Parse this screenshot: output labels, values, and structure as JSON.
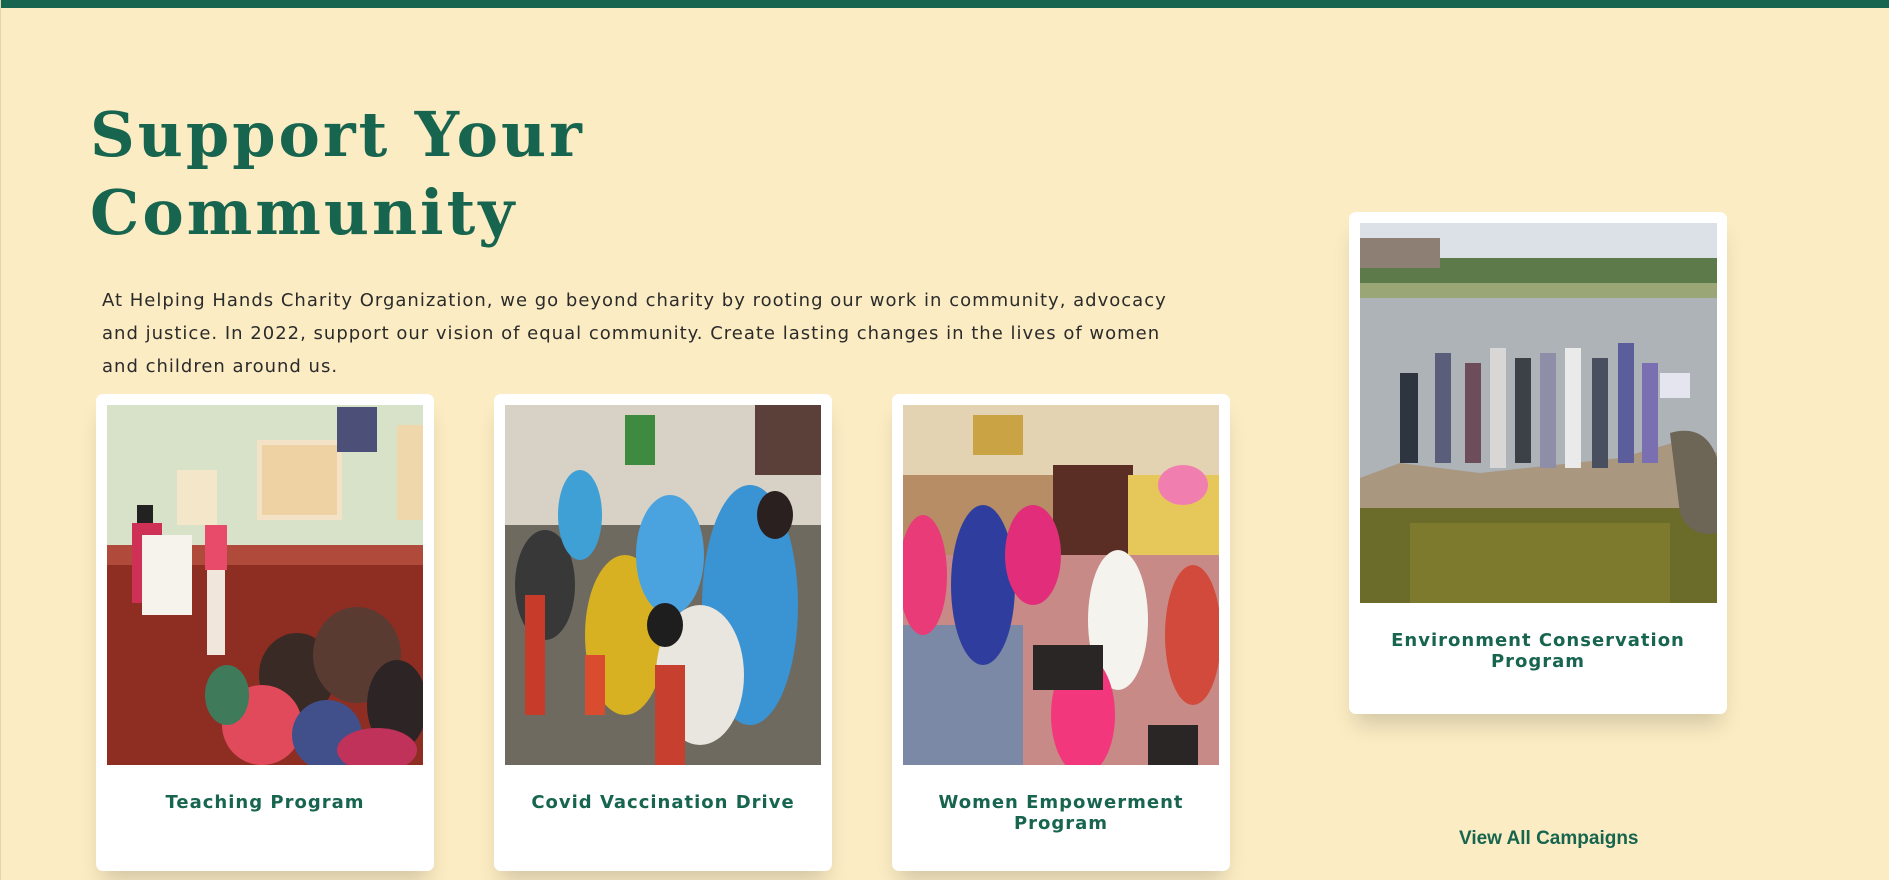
{
  "section": {
    "heading_line1": "Support Your",
    "heading_line2": "Community",
    "intro_text": "At Helping Hands Charity Organization, we go beyond charity by rooting our work in community, advocacy and justice. In 2022, support our vision of equal community. Create lasting changes in the lives of women and children around us."
  },
  "campaigns": [
    {
      "title": "Teaching Program"
    },
    {
      "title": "Covid Vaccination Drive"
    },
    {
      "title": "Women Empowerment Program"
    },
    {
      "title": "Environment Conservation Program"
    }
  ],
  "view_all_label": "View All Campaigns",
  "colors": {
    "background": "#fbecc3",
    "brand_green": "#17654f",
    "card": "#ffffff",
    "body_text": "#2b2b2b"
  }
}
